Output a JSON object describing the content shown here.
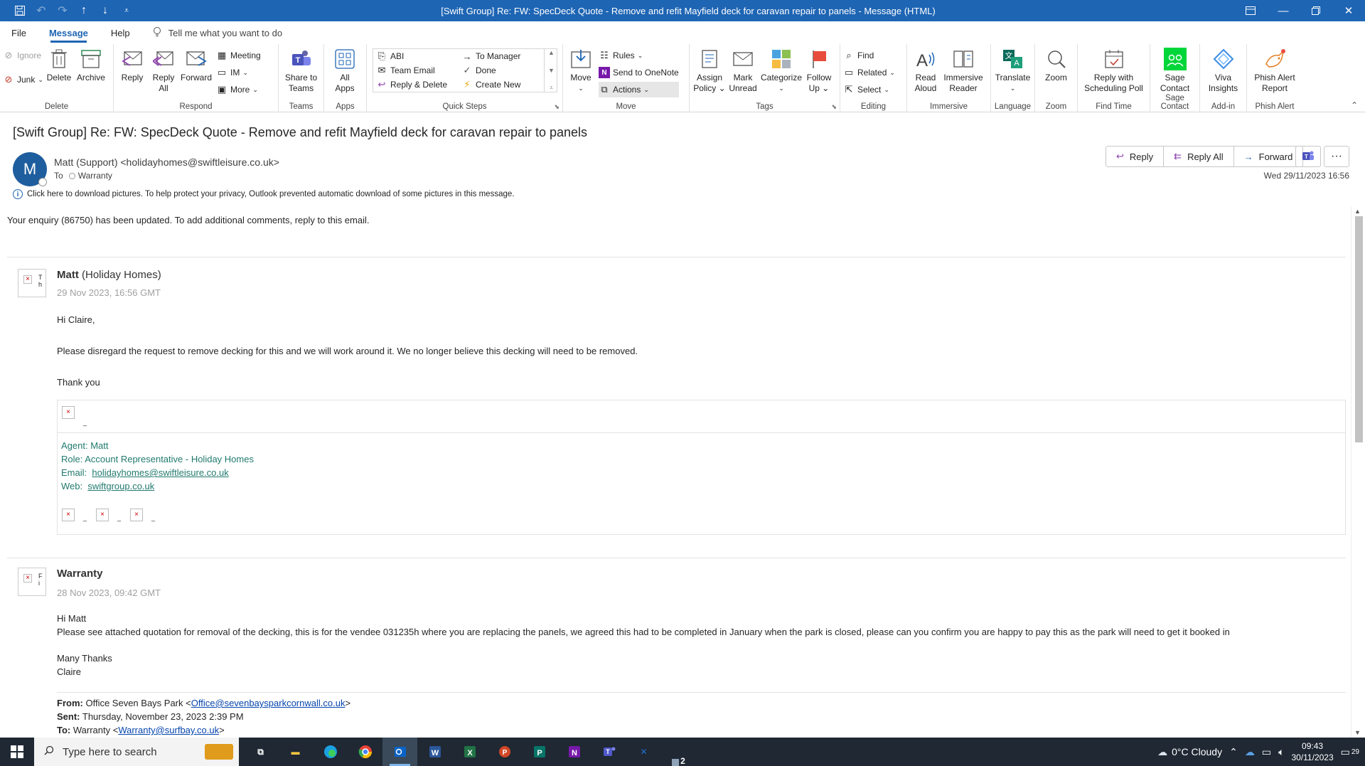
{
  "window": {
    "title": "[Swift Group] Re: FW: SpecDeck Quote - Remove and refit Mayfield deck for caravan repair to panels  -  Message (HTML)"
  },
  "menu": {
    "tabs": [
      "File",
      "Message",
      "Help"
    ],
    "tellme": "Tell me what you want to do"
  },
  "ribbon": {
    "delete": {
      "ignore": "Ignore",
      "junk": "Junk",
      "delete": "Delete",
      "archive": "Archive",
      "label": "Delete"
    },
    "respond": {
      "reply": "Reply",
      "reply_all_1": "Reply",
      "reply_all_2": "All",
      "forward": "Forward",
      "meeting": "Meeting",
      "im": "IM",
      "more": "More",
      "label": "Respond"
    },
    "teams": {
      "share_1": "Share to",
      "share_2": "Teams",
      "label": "Teams"
    },
    "apps": {
      "all_1": "All",
      "all_2": "Apps",
      "label": "Apps"
    },
    "quicksteps": {
      "abi": "ABI",
      "team_email": "Team Email",
      "reply_delete": "Reply & Delete",
      "to_manager": "To Manager",
      "done": "Done",
      "create_new": "Create New",
      "label": "Quick Steps"
    },
    "move": {
      "move": "Move",
      "rules": "Rules",
      "onenote": "Send to OneNote",
      "actions": "Actions",
      "label": "Move"
    },
    "tags": {
      "assign_1": "Assign",
      "assign_2": "Policy",
      "mark_1": "Mark",
      "mark_2": "Unread",
      "categorize": "Categorize",
      "follow_1": "Follow",
      "follow_2": "Up",
      "label": "Tags"
    },
    "editing": {
      "find": "Find",
      "related": "Related",
      "select": "Select",
      "label": "Editing"
    },
    "immersive": {
      "read_1": "Read",
      "read_2": "Aloud",
      "reader_1": "Immersive",
      "reader_2": "Reader",
      "label": "Immersive"
    },
    "language": {
      "translate": "Translate",
      "label": "Language"
    },
    "zoom": {
      "zoom": "Zoom",
      "label": "Zoom"
    },
    "findtime": {
      "poll_1": "Reply with",
      "poll_2": "Scheduling Poll",
      "label": "Find Time"
    },
    "sage": {
      "sage_1": "Sage",
      "sage_2": "Contact",
      "label": "Sage Contact"
    },
    "addin": {
      "viva_1": "Viva",
      "viva_2": "Insights",
      "label": "Add-in"
    },
    "phish": {
      "phish_1": "Phish Alert",
      "phish_2": "Report",
      "label": "Phish Alert"
    }
  },
  "message": {
    "subject": "[Swift Group] Re: FW: SpecDeck Quote - Remove and refit Mayfield deck for caravan repair to panels",
    "avatar_letter": "M",
    "sender": "Matt (Support) <holidayhomes@swiftleisure.co.uk>",
    "to_label": "To",
    "to_value": "Warranty",
    "date": "Wed 29/11/2023 16:56",
    "buttons": {
      "reply": "Reply",
      "reply_all": "Reply All",
      "forward": "Forward"
    },
    "infobar": "Click here to download pictures. To help protect your privacy, Outlook prevented automatic download of some pictures in this message."
  },
  "body": {
    "intro": "Your enquiry (86750) has been updated. To add additional comments, reply to this email.",
    "entry1": {
      "author_bold": "Matt",
      "author_rest": " (Holiday Homes)",
      "date": "29 Nov 2023, 16:56 GMT",
      "greeting": "Hi Claire,",
      "para": "Please disregard the request to remove decking for this and we will work around it. We no longer believe this decking will need to be removed.",
      "closing": "Thank you",
      "sig": {
        "agent": "Agent: Matt",
        "role": "Role: Account Representative - Holiday Homes",
        "email_label": "Email:",
        "email": "holidayhomes@swiftleisure.co.uk",
        "web_label": "Web:",
        "web": "swiftgroup.co.uk"
      }
    },
    "entry2": {
      "author": "Warranty",
      "date": "28 Nov 2023, 09:42 GMT",
      "greeting": "Hi Matt",
      "para": "Please see attached quotation for removal of the decking, this is for the vendee 031235h where you are replacing the panels, we agreed this had to be completed in January when the park is closed, please can you confirm you are happy to pay this as the park will need to get it booked in",
      "thanks": "Many Thanks",
      "name": "Claire",
      "from_label": "From:",
      "from_name": "Office Seven Bays Park <",
      "from_email": "Office@sevenbaysparkcornwall.co.uk",
      "from_end": ">",
      "sent_label": "Sent:",
      "sent_value": "Thursday, November 23, 2023 2:39 PM",
      "to_label": "To:",
      "to_name": "Warranty <",
      "to_email": "Warranty@surfbay.co.uk",
      "to_end": ">"
    }
  },
  "taskbar": {
    "search": "Type here to search",
    "weather": "0°C  Cloudy",
    "time": "09:43",
    "date": "30/11/2023",
    "badge": "2",
    "notif": "29"
  }
}
